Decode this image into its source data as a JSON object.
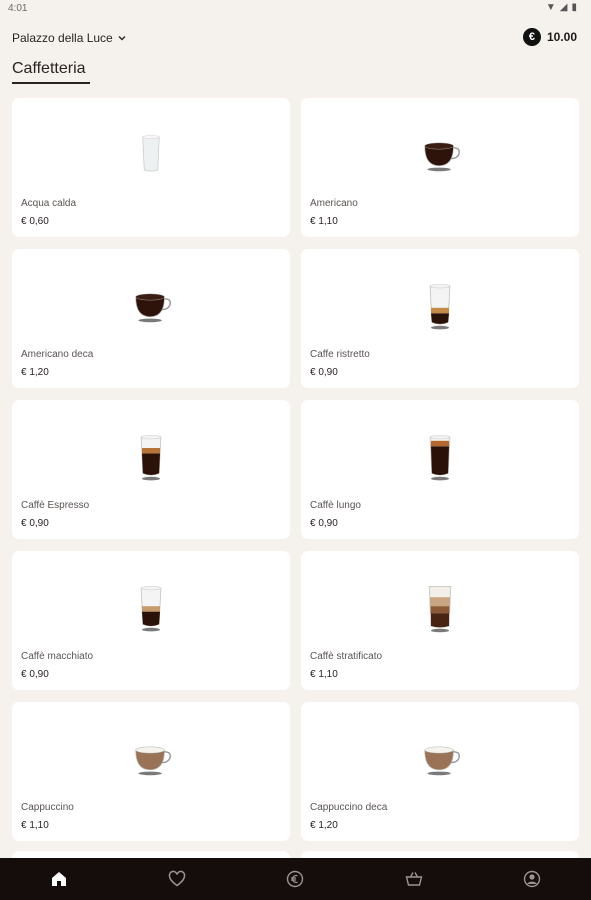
{
  "status": {
    "time": "4:01"
  },
  "header": {
    "location": "Palazzo della Luce",
    "balance": "10.00",
    "currency_symbol": "€"
  },
  "section": {
    "title": "Caffetteria"
  },
  "products": [
    {
      "name": "Acqua calda",
      "price": "€ 0,60",
      "icon": "glass-water-icon"
    },
    {
      "name": "Americano",
      "price": "€ 1,10",
      "icon": "cup-americano-icon"
    },
    {
      "name": "Americano deca",
      "price": "€ 1,20",
      "icon": "cup-americano-deca-icon"
    },
    {
      "name": "Caffe ristretto",
      "price": "€ 0,90",
      "icon": "glass-ristretto-icon"
    },
    {
      "name": "Caffè Espresso",
      "price": "€ 0,90",
      "icon": "glass-espresso-icon"
    },
    {
      "name": "Caffè lungo",
      "price": "€ 0,90",
      "icon": "glass-lungo-icon"
    },
    {
      "name": "Caffè macchiato",
      "price": "€ 0,90",
      "icon": "glass-macchiato-icon"
    },
    {
      "name": "Caffè stratificato",
      "price": "€ 1,10",
      "icon": "glass-stratificato-icon"
    },
    {
      "name": "Cappuccino",
      "price": "€ 1,10",
      "icon": "cup-cappuccino-icon"
    },
    {
      "name": "Cappuccino deca",
      "price": "€ 1,20",
      "icon": "cup-cappuccino-deca-icon"
    }
  ],
  "nav": [
    "home-icon",
    "heart-icon",
    "euro-icon",
    "basket-icon",
    "account-icon"
  ],
  "colors": {
    "background": "#f5f1ec",
    "nav_bg": "#150c0c",
    "card": "#ffffff"
  }
}
